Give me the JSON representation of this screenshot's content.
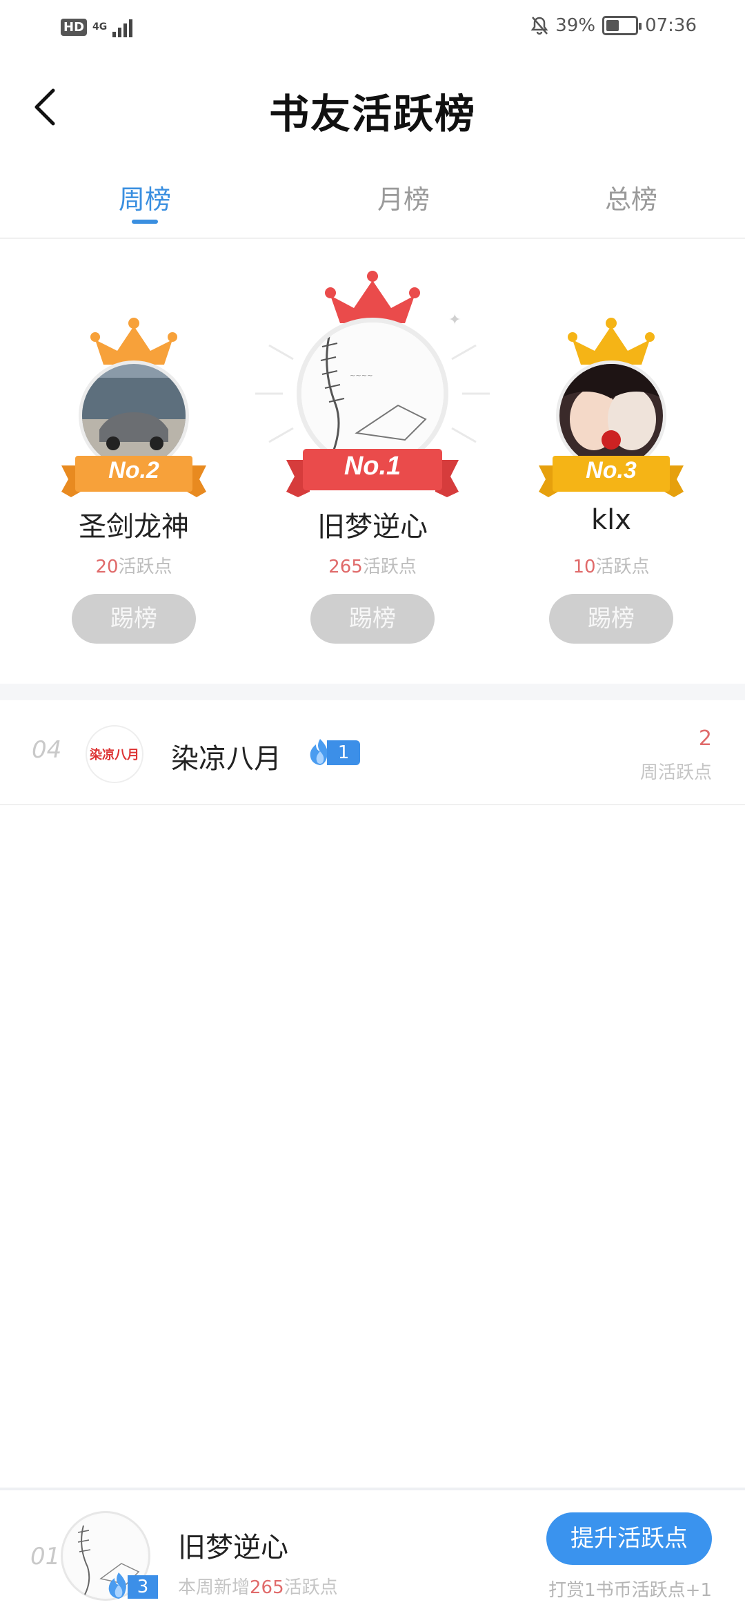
{
  "status_bar": {
    "hd": "HD",
    "network": "4G",
    "battery": "39%",
    "time": "07:36"
  },
  "header": {
    "title": "书友活跃榜"
  },
  "tabs": [
    {
      "label": "周榜",
      "active": true
    },
    {
      "label": "月榜",
      "active": false
    },
    {
      "label": "总榜",
      "active": false
    }
  ],
  "podium": [
    {
      "rank_label": "No.2",
      "name": "圣剑龙神",
      "points": "20",
      "points_unit": "活跃点",
      "button": "踢榜",
      "crown_color": "#f7a13a"
    },
    {
      "rank_label": "No.1",
      "name": "旧梦逆心",
      "points": "265",
      "points_unit": "活跃点",
      "button": "踢榜",
      "crown_color": "#ea4b4b"
    },
    {
      "rank_label": "No.3",
      "name": "klx",
      "points": "10",
      "points_unit": "活跃点",
      "button": "踢榜",
      "crown_color": "#f5b416"
    }
  ],
  "ranking": [
    {
      "rank": "04",
      "avatar_text": "染凉八月",
      "name": "染凉八月",
      "level": "1",
      "points": "2",
      "points_label": "周活跃点"
    }
  ],
  "my_rank": {
    "rank": "01",
    "name": "旧梦逆心",
    "level": "3",
    "sub_prefix": "本周新增",
    "sub_points": "265",
    "sub_suffix": "活跃点",
    "button": "提升活跃点",
    "tip": "打赏1书币活跃点+1"
  },
  "colors": {
    "accent": "#3a8fe0",
    "points": "#e06a6a",
    "silver": "#f7a13a",
    "gold": "#ea4b4b",
    "bronze": "#f5b416"
  }
}
